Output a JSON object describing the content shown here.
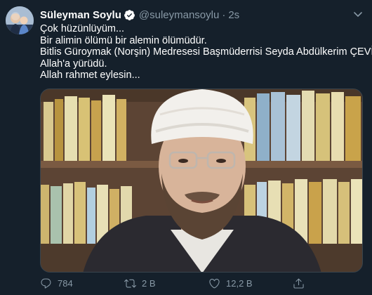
{
  "author": {
    "name": "Süleyman Soylu",
    "handle": "@suleymansoylu",
    "separator": "·",
    "time": "2s",
    "verified": true
  },
  "tweet": {
    "lines": [
      "Çok hüzünlüyüm...",
      "Bir alimin ölümü bir alemin ölümüdür.",
      "Bitlis Güroymak (Norşin) Medresesi Başmüderrisi Seyda Abdülkerim ÇEVİK",
      "Allah'a yürüdü.",
      "Allah rahmet eylesin..."
    ]
  },
  "actions": {
    "reply_count": "784",
    "retweet_count": "2 B",
    "like_count": "12,2 B"
  },
  "icons": {
    "avatar": "avatar-photo",
    "verified": "verified-badge-icon",
    "menu": "chevron-down-icon",
    "reply": "reply-icon",
    "retweet": "retweet-icon",
    "like": "like-icon",
    "share": "share-icon"
  },
  "colors": {
    "background": "#15202b",
    "text": "#ffffff",
    "muted": "#8899a6",
    "accent": "#1da1f2"
  }
}
